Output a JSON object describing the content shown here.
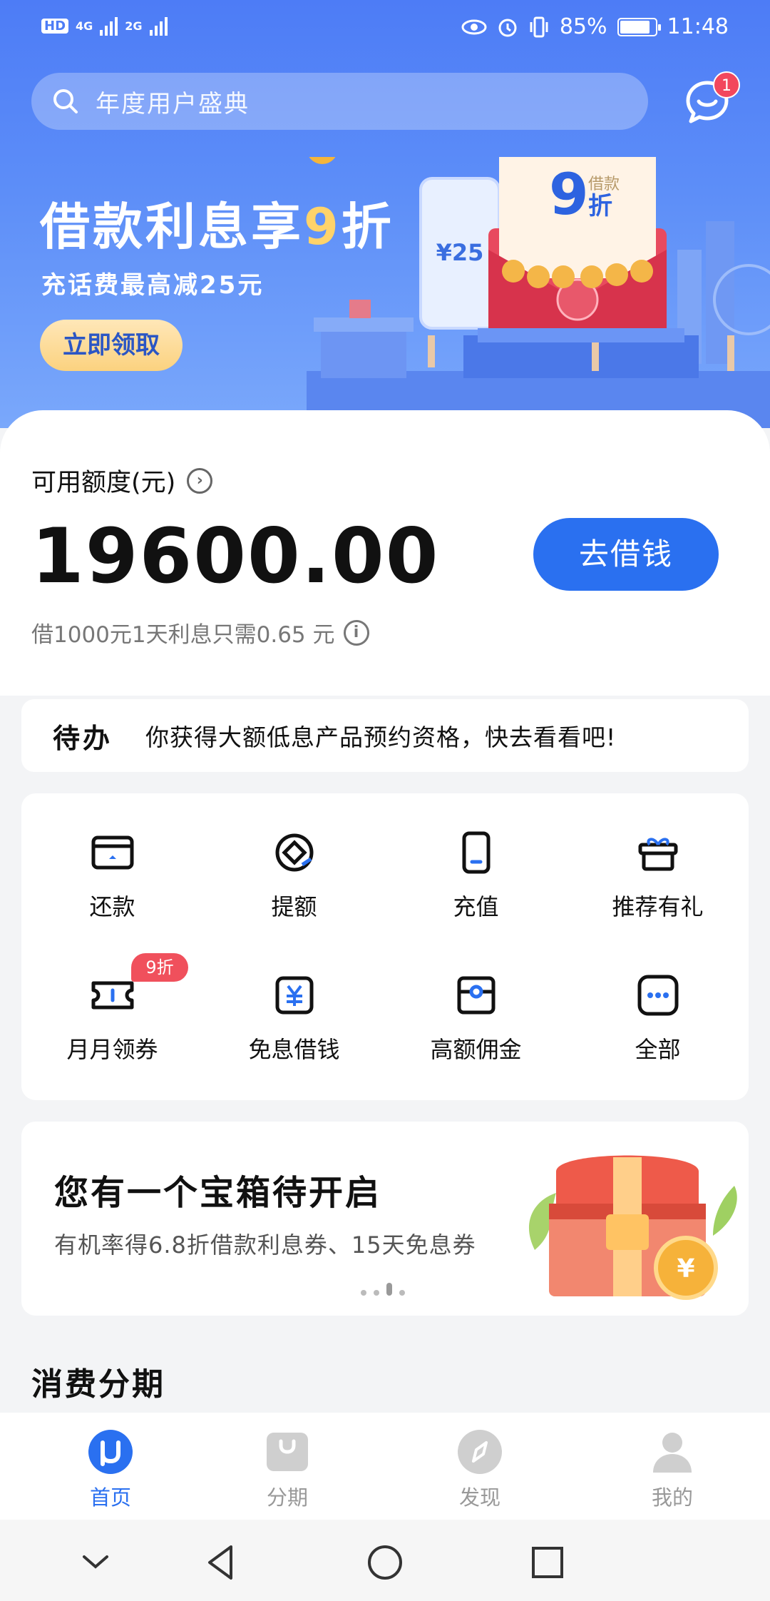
{
  "status_bar": {
    "hd": "HD",
    "net1": "4G",
    "net2": "2G",
    "battery": "85%",
    "battery_level": 0.85,
    "time": "11:48"
  },
  "search": {
    "placeholder": "年度用户盛典"
  },
  "messages": {
    "badge_count": "1"
  },
  "banner": {
    "title_prefix": "借款利息享",
    "title_num": "9",
    "title_suffix": "折",
    "subtitle": "充话费最高减25元",
    "button": "立即领取",
    "phone_text": "¥25",
    "card_num": "9",
    "card_top": "借款",
    "card_unit": "折"
  },
  "credit": {
    "label": "可用额度(元)",
    "value": "19600.00",
    "borrow_button": "去借钱",
    "note": "借1000元1天利息只需0.65 元"
  },
  "todo": {
    "tag": "待办",
    "text": "你获得大额低息产品预约资格，快去看看吧!"
  },
  "services": [
    {
      "label": "还款",
      "icon": "card-icon"
    },
    {
      "label": "提额",
      "icon": "limit-up-icon"
    },
    {
      "label": "充值",
      "icon": "phone-icon"
    },
    {
      "label": "推荐有礼",
      "icon": "gift-icon"
    },
    {
      "label": "月月领券",
      "icon": "coupon-icon"
    },
    {
      "label": "免息借钱",
      "icon": "yuan-icon"
    },
    {
      "label": "高额佣金",
      "icon": "wallet-icon"
    },
    {
      "label": "全部",
      "icon": "more-icon"
    }
  ],
  "promo_tag": "9折",
  "chest": {
    "title": "您有一个宝箱待开启",
    "subtitle": "有机率得6.8折借款利息券、15天免息券",
    "coin": "¥"
  },
  "section": {
    "title": "消费分期"
  },
  "tabs": [
    {
      "label": "首页",
      "active": true
    },
    {
      "label": "分期",
      "active": false
    },
    {
      "label": "发现",
      "active": false
    },
    {
      "label": "我的",
      "active": false
    }
  ],
  "colors": {
    "primary": "#2a70f0",
    "badge": "#f2475d",
    "hero_top": "#4d7cf6"
  }
}
